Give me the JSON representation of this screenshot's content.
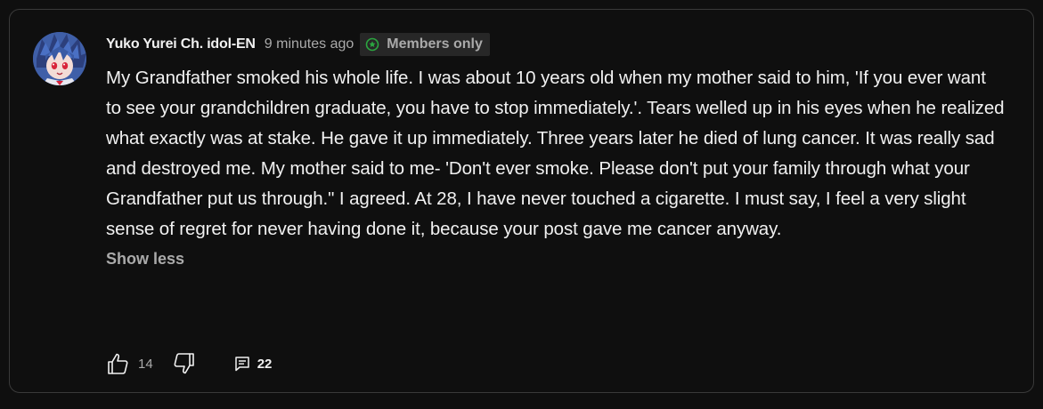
{
  "comment": {
    "author": "Yuko Yurei Ch. idol-EN",
    "timestamp": "9 minutes ago",
    "badge": {
      "label": "Members only",
      "icon": "members-badge-icon",
      "color": "#2ba640"
    },
    "text": "My Grandfather smoked his whole life. I was about 10 years old when my mother said to him, 'If you ever want to see your grandchildren graduate, you have to stop immediately.'. Tears welled up in his eyes when he realized what exactly was at stake. He gave it up immediately. Three years later he died of lung cancer. It was really sad and destroyed me. My mother said to me- 'Don't ever smoke. Please don't put your family through what your Grandfather put us through.\" I agreed. At 28, I have never touched a cigarette. I must say, I feel a very slight sense of regret for never having done it, because your post gave me cancer anyway.",
    "show_less_label": "Show less"
  },
  "actions": {
    "like_icon": "thumbs-up-icon",
    "like_count": "14",
    "dislike_icon": "thumbs-down-icon",
    "reply_icon": "comment-icon",
    "reply_count": "22"
  },
  "colors": {
    "background": "#0f0f0f",
    "border": "#3a3a3a",
    "text_primary": "#f1f1f1",
    "text_secondary": "#aaaaaa",
    "badge_bg": "#272727"
  }
}
